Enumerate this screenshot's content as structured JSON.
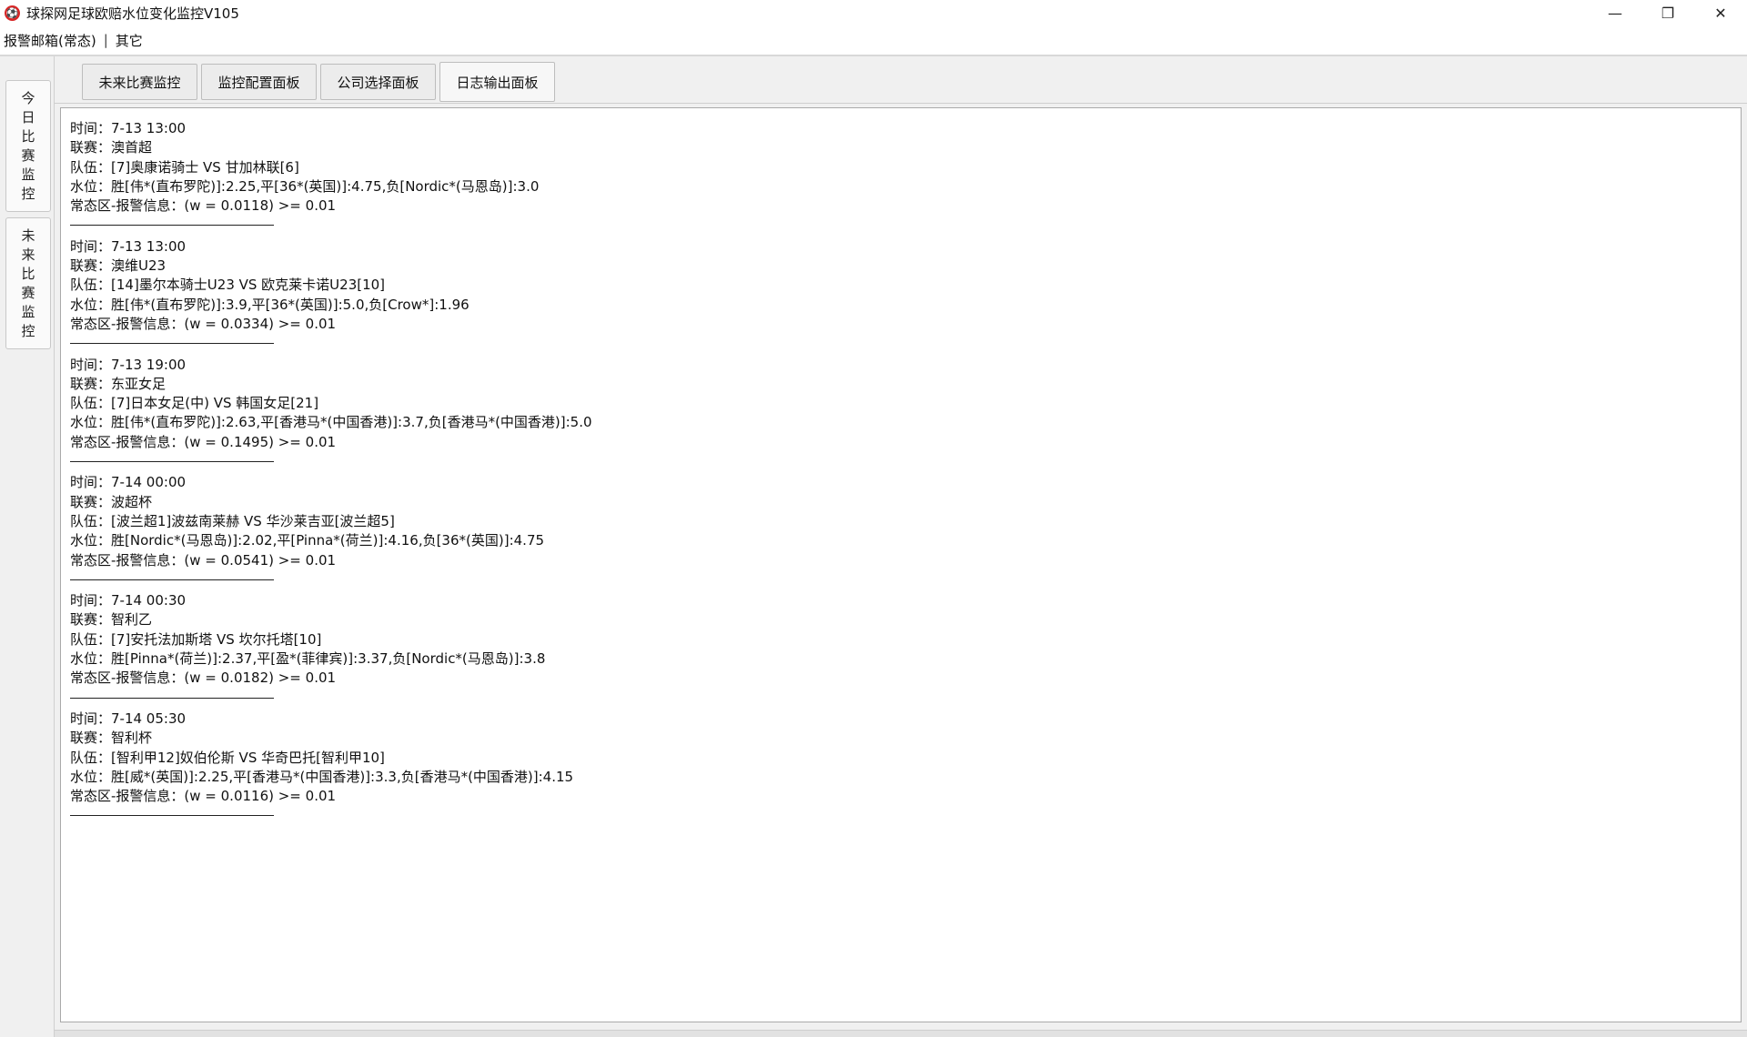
{
  "window": {
    "title": "球探网足球欧赔水位变化监控V105",
    "icon_name": "soccer-ball-app-icon",
    "controls": {
      "minimize": "—",
      "restore": "❐",
      "close": "✕"
    }
  },
  "menu": {
    "items": [
      "报警邮箱(常态)",
      "其它"
    ],
    "separator": "|"
  },
  "side_tabs": [
    {
      "label": [
        "今",
        "日",
        "比",
        "赛",
        "监",
        "控"
      ],
      "active": true
    },
    {
      "label": [
        "未",
        "来",
        "比",
        "赛",
        "监",
        "控"
      ],
      "active": false
    }
  ],
  "top_tabs": [
    {
      "label": "未来比赛监控",
      "active": false
    },
    {
      "label": "监控配置面板",
      "active": false
    },
    {
      "label": "公司选择面板",
      "active": false
    },
    {
      "label": "日志输出面板",
      "active": true
    }
  ],
  "log": {
    "entries": [
      {
        "time": "时间：7-13 13:00",
        "league": "联赛：澳首超",
        "teams": "队伍：[7]奥康诺骑士 VS 甘加林联[6]",
        "odds": "水位：胜[伟*(直布罗陀)]:2.25,平[36*(英国)]:4.75,负[Nordic*(马恩岛)]:3.0",
        "alert": "常态区-报警信息：(w = 0.0118) >= 0.01"
      },
      {
        "time": "时间：7-13 13:00",
        "league": "联赛：澳维U23",
        "teams": "队伍：[14]墨尔本骑士U23 VS 欧克莱卡诺U23[10]",
        "odds": "水位：胜[伟*(直布罗陀)]:3.9,平[36*(英国)]:5.0,负[Crow*]:1.96",
        "alert": "常态区-报警信息：(w = 0.0334) >= 0.01"
      },
      {
        "time": "时间：7-13 19:00",
        "league": "联赛：东亚女足",
        "teams": "队伍：[7]日本女足(中) VS 韩国女足[21]",
        "odds": "水位：胜[伟*(直布罗陀)]:2.63,平[香港马*(中国香港)]:3.7,负[香港马*(中国香港)]:5.0",
        "alert": "常态区-报警信息：(w = 0.1495) >= 0.01"
      },
      {
        "time": "时间：7-14 00:00",
        "league": "联赛：波超杯",
        "teams": "队伍：[波兰超1]波兹南莱赫 VS 华沙莱吉亚[波兰超5]",
        "odds": "水位：胜[Nordic*(马恩岛)]:2.02,平[Pinna*(荷兰)]:4.16,负[36*(英国)]:4.75",
        "alert": "常态区-报警信息：(w = 0.0541) >= 0.01"
      },
      {
        "time": "时间：7-14 00:30",
        "league": "联赛：智利乙",
        "teams": "队伍：[7]安托法加斯塔 VS 坎尔托塔[10]",
        "odds": "水位：胜[Pinna*(荷兰)]:2.37,平[盈*(菲律宾)]:3.37,负[Nordic*(马恩岛)]:3.8",
        "alert": "常态区-报警信息：(w = 0.0182) >= 0.01"
      },
      {
        "time": "时间：7-14 05:30",
        "league": "联赛：智利杯",
        "teams": "队伍：[智利甲12]奴伯伦斯 VS 华奇巴托[智利甲10]",
        "odds": "水位：胜[威*(英国)]:2.25,平[香港马*(中国香港)]:3.3,负[香港马*(中国香港)]:4.15",
        "alert": "常态区-报警信息：(w = 0.0116) >= 0.01"
      }
    ]
  }
}
